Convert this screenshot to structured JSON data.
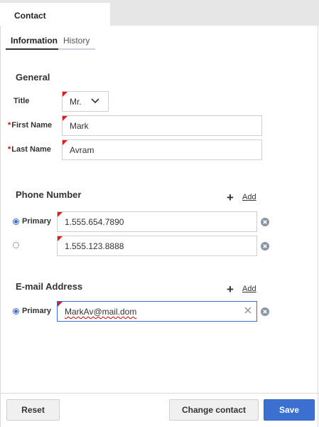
{
  "window": {
    "tab_title": "Contact"
  },
  "tabs": [
    {
      "label": "Information",
      "active": true
    },
    {
      "label": "History",
      "active": false
    }
  ],
  "general": {
    "heading": "General",
    "title_label": "Title",
    "title_value": "Mr.",
    "first_name_label": "First Name",
    "first_name_value": "Mark",
    "last_name_label": "Last Name",
    "last_name_value": "Avram",
    "required_marker": "*"
  },
  "phone": {
    "heading": "Phone Number",
    "add_label": "Add",
    "primary_label": "Primary",
    "numbers": [
      {
        "value": "1.555.654.7890",
        "primary": true
      },
      {
        "value": "1.555.123.8888",
        "primary": false
      }
    ]
  },
  "email": {
    "heading": "E-mail Address",
    "add_label": "Add",
    "primary_label": "Primary",
    "value": "MarkAv@mail.dom"
  },
  "footer": {
    "reset_label": "Reset",
    "change_label": "Change contact",
    "save_label": "Save"
  },
  "colors": {
    "accent": "#3b6fd0",
    "required": "#d40000"
  }
}
